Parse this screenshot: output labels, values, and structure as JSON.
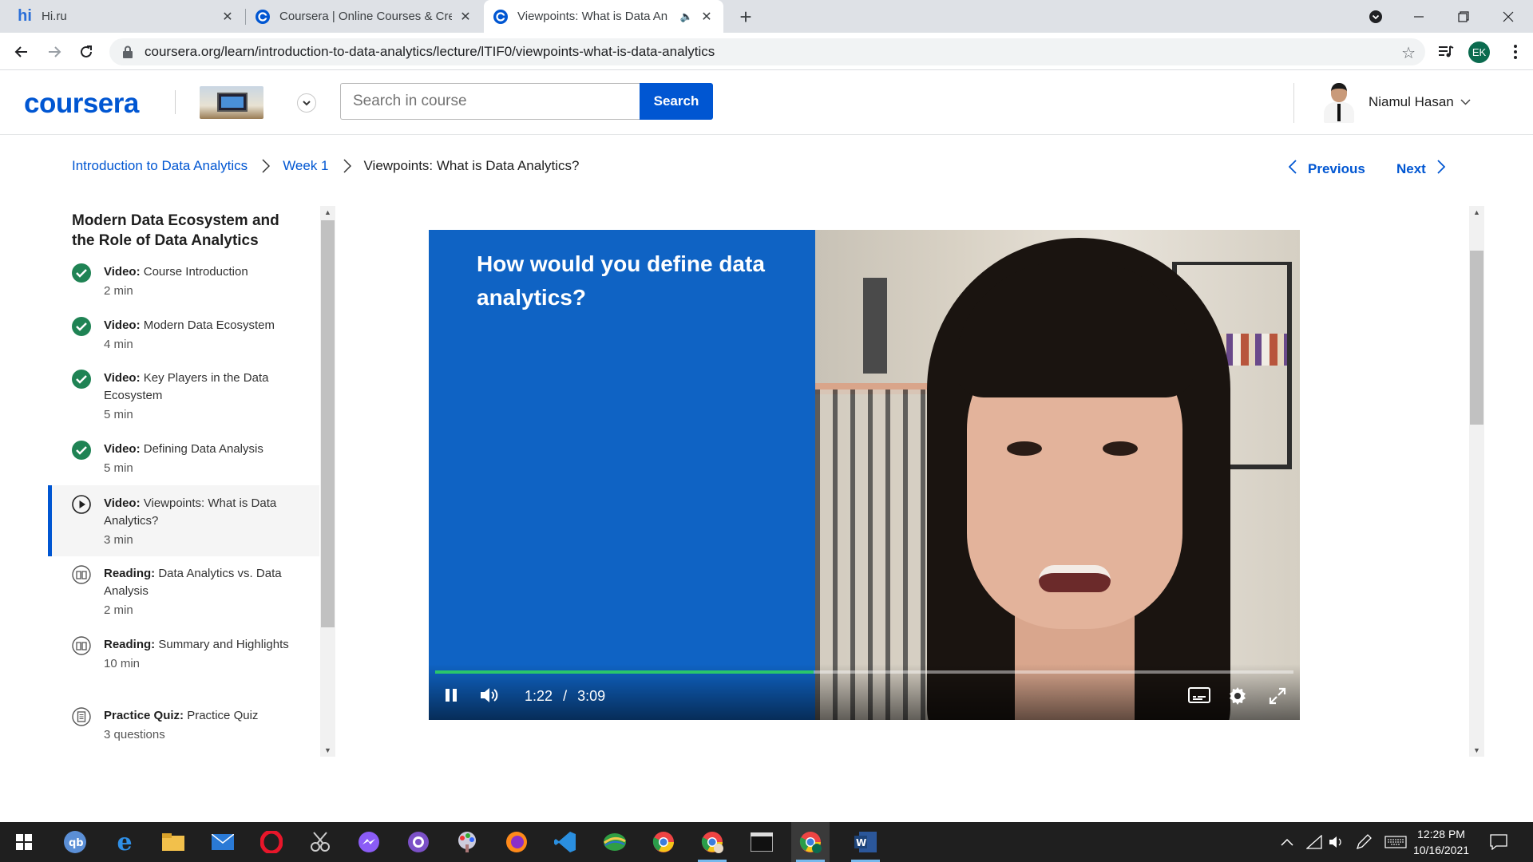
{
  "browser": {
    "tabs": [
      {
        "title": "Hi.ru",
        "favicon": "hi-favicon"
      },
      {
        "title": "Coursera | Online Courses & Crec",
        "favicon": "coursera-favicon"
      },
      {
        "title": "Viewpoints: What is Data An",
        "favicon": "coursera-favicon",
        "active": true,
        "audio": true
      }
    ],
    "url": "coursera.org/learn/introduction-to-data-analytics/lecture/lTIF0/viewpoints-what-is-data-analytics",
    "profile_initials": "EK"
  },
  "header": {
    "logo": "coursera",
    "search_placeholder": "Search in course",
    "search_button": "Search",
    "user_name": "Niamul Hasan"
  },
  "breadcrumb": {
    "course": "Introduction to Data Analytics",
    "week": "Week 1",
    "current": "Viewpoints: What is Data Analytics?"
  },
  "nav": {
    "previous": "Previous",
    "next": "Next"
  },
  "sidebar": {
    "title": "Modern Data Ecosystem and the Role of Data Analytics",
    "items": [
      {
        "kind": "Video:",
        "title": "Course Introduction",
        "meta": "2 min",
        "status": "completed"
      },
      {
        "kind": "Video:",
        "title": "Modern Data Ecosystem",
        "meta": "4 min",
        "status": "completed"
      },
      {
        "kind": "Video:",
        "title": "Key Players in the Data Ecosystem",
        "meta": "5 min",
        "status": "completed"
      },
      {
        "kind": "Video:",
        "title": "Defining Data Analysis",
        "meta": "5 min",
        "status": "completed"
      },
      {
        "kind": "Video:",
        "title": "Viewpoints: What is Data Analytics?",
        "meta": "3 min",
        "status": "current"
      },
      {
        "kind": "Reading:",
        "title": "Data Analytics vs. Data Analysis",
        "meta": "2 min",
        "status": "reading"
      },
      {
        "kind": "Reading:",
        "title": "Summary and Highlights",
        "meta": "10 min",
        "status": "reading"
      },
      {
        "kind": "Practice Quiz:",
        "title": "Practice Quiz",
        "meta": "3 questions",
        "status": "quiz"
      }
    ]
  },
  "video": {
    "slide_text": "How would you define data analytics?",
    "current_time": "1:22",
    "separator": "/",
    "duration": "3:09",
    "progress_fraction": 0.441
  },
  "taskbar": {
    "time": "12:28 PM",
    "date": "10/16/2021"
  },
  "colors": {
    "brand": "#0056d2",
    "complete": "#1f8354",
    "slide_blue": "#0f63c4",
    "progress": "#2ac56b"
  }
}
